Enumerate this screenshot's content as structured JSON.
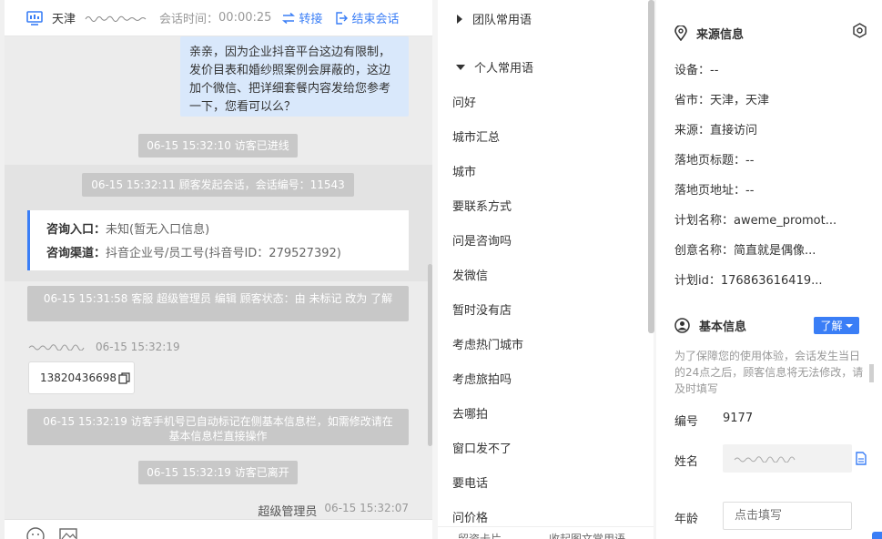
{
  "header": {
    "city": "天津",
    "session_time_label": "会话时间：",
    "session_time": "00:00:25",
    "transfer_label": "转接",
    "end_label": "结束会话"
  },
  "messages": {
    "agent_text": "亲亲，因为企业抖音平台这边有限制，发价目表和婚纱照案例会屏蔽的，这边加个微信、把详细套餐内容发给您参考一下，您看可以么？",
    "sys_entered": "06-15 15:32:10 访客已进线",
    "sys_session": "06-15 15:32:11 顾客发起会话，会话编号：11543",
    "info_entry_label": "咨询入口：",
    "info_entry_value": "未知(暂无入口信息)",
    "info_channel_label": "咨询渠道：",
    "info_channel_value": "抖音企业号/员工号(抖音号ID：279527392)",
    "sys_status": "06-15 15:31:58 客服 超级管理员 编辑 顾客状态：由 未标记 改为 了解",
    "visitor_time": "06-15 15:32:19",
    "phone": "13820436698",
    "sys_phone_tag": "06-15 15:32:19 访客手机号已自动标记在侧基本信息栏，如需修改请在基本信息栏直接操作",
    "sys_left": "06-15 15:32:19 访客已离开",
    "agent_name": "超级管理员",
    "agent_time": "06-15 15:32:07"
  },
  "phrases": {
    "team_group": "团队常用语",
    "personal_group": "个人常用语",
    "items": [
      "问好",
      "城市汇总",
      "城市",
      "要联系方式",
      "问是咨询吗",
      "发微信",
      "暂时没有店",
      "考虑热门城市",
      "考虑旅拍吗",
      "去哪拍",
      "窗口发不了",
      "要电话",
      "问价格"
    ],
    "footer_left": "留资卡片",
    "footer_right": "收起图文常用语"
  },
  "source": {
    "title": "来源信息",
    "device": "设备：--",
    "province": "省市：天津，天津",
    "origin": "来源：直接访问",
    "landing_title": "落地页标题：--",
    "landing_url": "落地页地址：--",
    "plan_name": "计划名称：aweme_promot...",
    "creative_name": "创意名称：简直就是偶像...",
    "plan_id": "计划id：176863616419..."
  },
  "basic": {
    "title": "基本信息",
    "learn_label": "了解",
    "notice": "为了保障您的使用体验，会话发生当日的24点之后，顾客信息将无法修改，请及时填写",
    "id_label": "编号",
    "id_value": "9177",
    "name_label": "姓名",
    "age_label": "年龄",
    "age_placeholder": "点击填写"
  },
  "colors": {
    "accent": "#3a7ef6",
    "agent_bubble": "#d9e8fb",
    "system_bar": "#c8c8c8"
  }
}
